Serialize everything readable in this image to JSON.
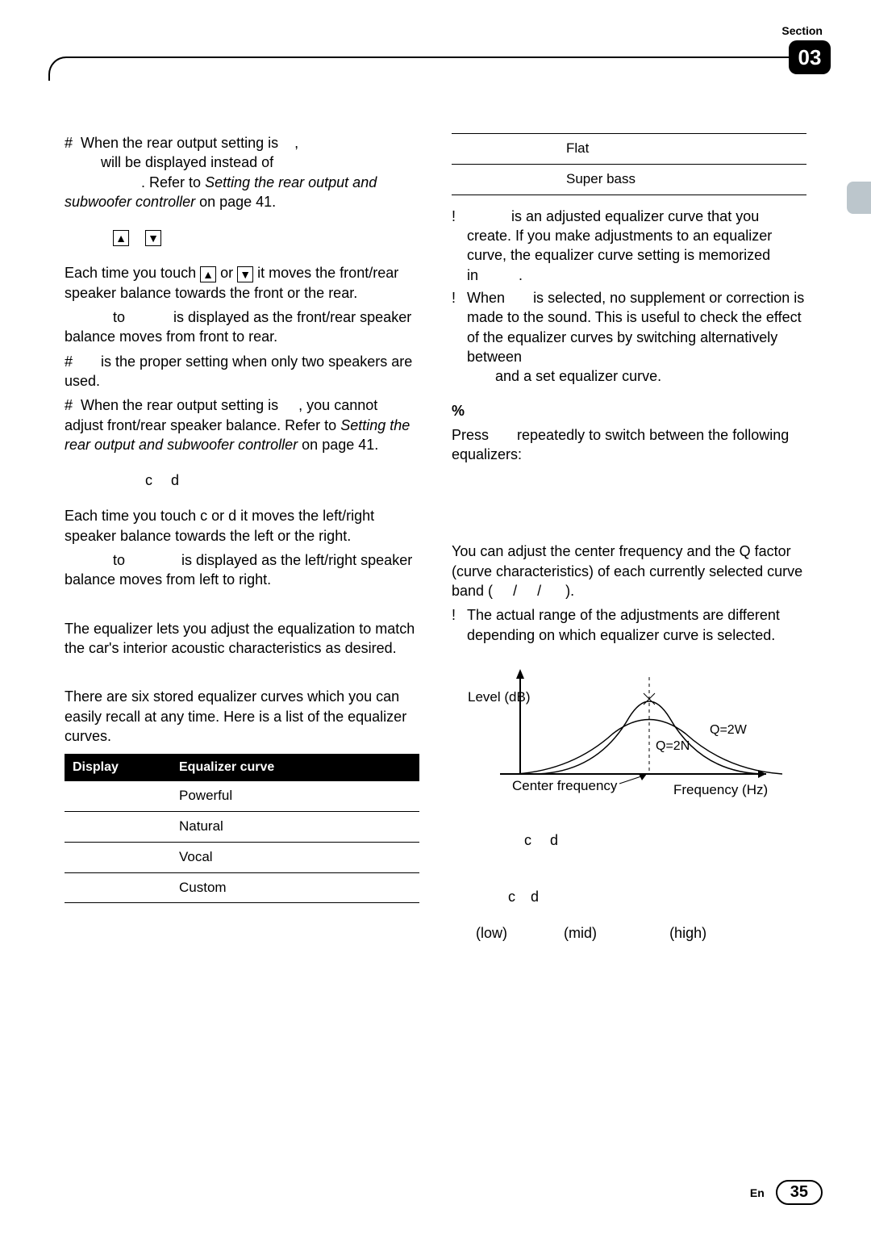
{
  "section": {
    "label": "Section",
    "number": "03"
  },
  "left": {
    "rear_note_1a": "When the rear output setting is",
    "rear_note_1b": "will be displayed instead of",
    "rear_note_1c": ". Refer to ",
    "rear_note_1c_ital": "Setting the rear output and subwoofer controller",
    "rear_note_1d": " on page 41.",
    "touch_each": "Each time you touch ",
    "touch_or": " or ",
    "touch_moves": " it moves the front/rear speaker balance towards the front or the rear.",
    "to_word": "to",
    "is_displayed_fr": "is displayed as the front/rear speaker balance moves from front to rear.",
    "proper_two": "is the proper setting when only two speakers are used.",
    "rear_sw_a": "When the rear output setting is",
    "rear_sw_b": ", you cannot adjust front/rear speaker balance. Refer to ",
    "rear_sw_ital": "Setting the rear output and subwoofer controller",
    "rear_sw_c": " on page 41.",
    "cd_letters": "c      d",
    "touch_cd": "Each time you touch c  or d  it moves the left/right speaker balance towards the left or the right.",
    "is_displayed_lr": "is displayed as the left/right speaker balance moves from left to right.",
    "eq_intro": "The equalizer lets you adjust the equalization to match the car's interior acoustic characteristics as desired.",
    "eq_recall": "There are six stored equalizer curves which you can easily recall at any time. Here is a list of the equalizer curves.",
    "table": {
      "h1": "Display",
      "h2": "Equalizer curve",
      "rows": [
        {
          "c1": "",
          "c2": "Powerful"
        },
        {
          "c1": "",
          "c2": "Natural"
        },
        {
          "c1": "",
          "c2": "Vocal"
        },
        {
          "c1": "",
          "c2": "Custom"
        }
      ]
    }
  },
  "right": {
    "table2": {
      "rows": [
        {
          "c1": "",
          "c2": "Flat"
        },
        {
          "c1": "",
          "c2": "Super bass"
        }
      ]
    },
    "custom_a": "is an adjusted equalizer curve that you create. If you make adjustments to an equalizer curve, the equalizer curve setting is memorized in",
    "custom_b": ".",
    "flat_a": "When",
    "flat_b": "is selected, no supplement or correction is made to the sound. This is useful to check the effect of the equalizer curves by switching alternatively between",
    "flat_c": "and a set equalizer curve.",
    "pct": "%",
    "press_rep_a": "Press",
    "press_rep_b": "repeatedly to switch between the following equalizers:",
    "qfactor_a": "You can adjust the center frequency and the Q factor (curve characteristics) of each currently selected curve band (",
    "qfactor_slash": "/",
    "qfactor_b": ").",
    "qfactor_note": "The actual range of the adjustments are different depending on which equalizer curve is selected.",
    "chart": {
      "level": "Level (dB)",
      "center": "Center frequency",
      "q2n": "Q=2N",
      "q2w": "Q=2W",
      "freq": "Frequency (Hz)"
    },
    "cd1": "c     d",
    "cd2": "c    d",
    "low": "(low)",
    "mid": "(mid)",
    "high": "(high)"
  },
  "footer": {
    "en": "En",
    "page": "35"
  },
  "chart_data": {
    "type": "line",
    "title": "Equalizer Q factor curves",
    "xlabel": "Frequency (Hz)",
    "ylabel": "Level (dB)",
    "series": [
      {
        "name": "Q=2N",
        "description": "narrow bell curve centered at center frequency"
      },
      {
        "name": "Q=2W",
        "description": "wide bell curve centered at same center frequency, lower peak"
      }
    ],
    "annotations": [
      "Center frequency marked with dashed vertical line",
      "Up arrow on level axis",
      "Right arrow on frequency axis"
    ]
  }
}
